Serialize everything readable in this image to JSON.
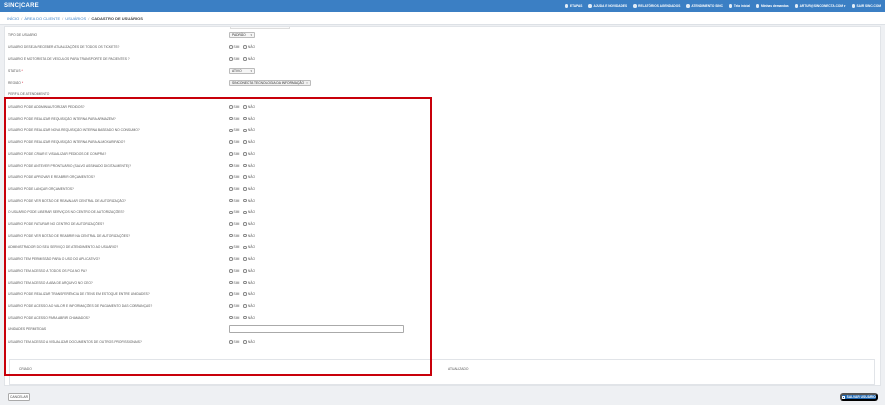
{
  "app": {
    "brand": "SINC|CARE"
  },
  "topnav": [
    {
      "label": "ETAPAS",
      "icon": "steps-icon"
    },
    {
      "label": "AJUDA E NOVIDADES",
      "icon": "help-icon"
    },
    {
      "label": "RELATÓRIOS AGENDADOS",
      "icon": "reports-icon"
    },
    {
      "label": "ATENDIMENTO SINC",
      "icon": "support-icon"
    },
    {
      "label": "Tela inicial",
      "icon": "home-icon"
    },
    {
      "label": "Minhas demandas",
      "icon": "tasks-icon"
    },
    {
      "label": "ARTUR@SINCONECTA.COM ▾",
      "icon": "user-icon"
    },
    {
      "label": "SAIR SINC.COM",
      "icon": "logout-icon"
    }
  ],
  "breadcrumb": {
    "items": [
      "INÍCIO",
      "ÁREA DO CLIENTE",
      "USUÁRIOS"
    ],
    "current": "CADASTRO DE USUÁRIOS"
  },
  "radio_options": {
    "yes": "SIM",
    "no": "NÃO"
  },
  "top_fields": [
    {
      "label": "TIPO DE USUÁRIO",
      "type": "select",
      "value": "PADRÃO",
      "required": false
    },
    {
      "label": "USUÁRIO DESEJA RECEBER ATUALIZAÇÕES DE TODOS OS TICKETS?",
      "type": "radio",
      "required": false
    },
    {
      "label": "USUÁRIO É MOTORISTA DE VEÍCULOS PARA TRANSPORTE DE PACIENTES ?",
      "type": "radio",
      "required": false
    },
    {
      "label": "STATUS",
      "type": "select",
      "value": "ATIVO",
      "required": true
    },
    {
      "label": "REGIÃO",
      "type": "tag",
      "value": "SINCONECTA TECNOLOGIA DA INFORMAÇÃO",
      "required": true
    },
    {
      "label": "PERFIL DE ATENDIMENTO",
      "type": "none",
      "required": false
    }
  ],
  "permission_questions": [
    "USUÁRIO PODE ADDMIN/AUTORIZAR PEDIDOS?",
    "USUÁRIO PODE REALIZAR REQUISIÇÃO INTERNA PARA ARMAZÉM?",
    "USUÁRIO PODE REALIZAR NOVA REQUISIÇÃO INTERNA BASEADO NO CONSUMO?",
    "USUÁRIO PODE REALIZAR REQUISIÇÃO INTERNA PARA ALMOXARIFADO?",
    "USUÁRIO PODE CRIAR E VISUALIZAR PEDIDOS DE COMPRA?",
    "USUÁRIO PODE ANTEVER PRONTUÁRIO (SALVO ASSINADO DIGITALMENTE)?",
    "USUÁRIO PODE APROVAR E REABRIR ORÇAMENTOS?",
    "USUÁRIO PODE LANÇAR ORÇAMENTOS?",
    "USUÁRIO PODE VER BOTÃO DE REAVALIAR CENTRAL DE AUTORIZAÇÃO?",
    "O USUÁRIO PODE LIBERAR SERVIÇOS NO CENTRO DE AUTORIZAÇÕES?",
    "USUÁRIO PODE FATURAR NO CENTRO DE AUTORIZAÇÕES?",
    "USUÁRIO PODE VER BOTÃO DE REABRIR NA CENTRAL DE AUTORIZAÇÕES?",
    "ADMINISTRADOR DO SEU SERVIÇO DE ATENDIMENTO AO USUÁRIO?",
    "USUÁRIO TEM PERMISSÃO PARA O USO DO APLICATIVO?",
    "USUÁRIO TEM ACESSO À TODOS OS PCA NO PA?",
    "USUÁRIO TEM ACESSO À ABA DE ARQUIVO NO CEO?",
    "USUÁRIO PODE REALIZAR TRANSFERÊNCIA DE ITENS EM ESTOQUE ENTRE UNIDADES?",
    "USUÁRIO PODE ACESSO AO VALOR E INFORMAÇÕES DE PAGAMENTO DAS COBRANÇAS?",
    "USUÁRIO PODE ACESSO PARA ABRIR CHAMADOS?"
  ],
  "text_field": {
    "label": "UNIDADES PERMITIDAS",
    "value": ""
  },
  "last_question": "USUÁRIO TEM ACESSO A VISUALIZAR DOCUMENTOS DE OUTROS PROFISSIONAIS?",
  "grid": {
    "col1": "CRIADO",
    "col2": "ATUALIZADO"
  },
  "actions": {
    "cancel": "CANCELAR",
    "save": "SALVAR USUÁRIO"
  }
}
